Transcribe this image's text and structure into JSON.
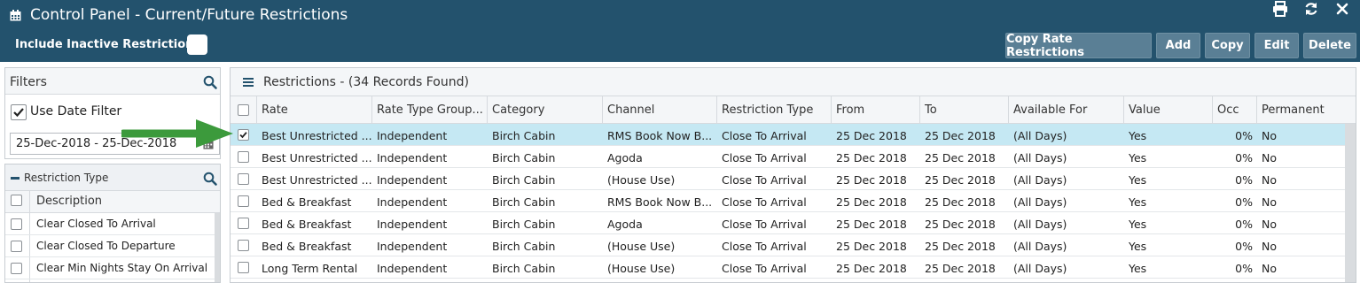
{
  "window": {
    "title": "Control Panel - Current/Future Restrictions",
    "icons": [
      "calendar-icon",
      "print-icon",
      "refresh-icon",
      "close-icon"
    ]
  },
  "toolbar": {
    "include_inactive_label": "Include Inactive Restrictions",
    "include_inactive_checked": false,
    "buttons": {
      "copy_rate_restrictions": "Copy Rate Restrictions",
      "add": "Add",
      "copy": "Copy",
      "edit": "Edit",
      "delete": "Delete"
    }
  },
  "filters": {
    "title": "Filters",
    "use_date_filter_label": "Use Date Filter",
    "use_date_filter_checked": true,
    "date_range_value": "25-Dec-2018 - 25-Dec-2018"
  },
  "restriction_type_filter": {
    "title": "Restriction Type",
    "column_header": "Description",
    "items": [
      "Clear Closed To Arrival",
      "Clear Closed To Departure",
      "Clear Min Nights Stay On Arrival"
    ]
  },
  "grid": {
    "title": "Restrictions - (34 Records Found)",
    "columns": [
      "Rate",
      "Rate Type Group...",
      "Category",
      "Channel",
      "Restriction Type",
      "From",
      "To",
      "Available For",
      "Value",
      "Occ",
      "Permanent"
    ],
    "rows": [
      {
        "selected": true,
        "rate": "Best Unrestricted ...",
        "rate_type_group": "Independent",
        "category": "Birch Cabin",
        "channel": "RMS Book Now B...",
        "restriction_type": "Close To Arrival",
        "from": "25 Dec 2018",
        "to": "25 Dec 2018",
        "available_for": "(All Days)",
        "value": "Yes",
        "occ": "0%",
        "permanent": "No"
      },
      {
        "selected": false,
        "rate": "Best Unrestricted ...",
        "rate_type_group": "Independent",
        "category": "Birch Cabin",
        "channel": "Agoda",
        "restriction_type": "Close To Arrival",
        "from": "25 Dec 2018",
        "to": "25 Dec 2018",
        "available_for": "(All Days)",
        "value": "Yes",
        "occ": "0%",
        "permanent": "No"
      },
      {
        "selected": false,
        "rate": "Best Unrestricted ...",
        "rate_type_group": "Independent",
        "category": "Birch Cabin",
        "channel": "(House Use)",
        "restriction_type": "Close To Arrival",
        "from": "25 Dec 2018",
        "to": "25 Dec 2018",
        "available_for": "(All Days)",
        "value": "Yes",
        "occ": "0%",
        "permanent": "No"
      },
      {
        "selected": false,
        "rate": "Bed & Breakfast",
        "rate_type_group": "Independent",
        "category": "Birch Cabin",
        "channel": "RMS Book Now B...",
        "restriction_type": "Close To Arrival",
        "from": "25 Dec 2018",
        "to": "25 Dec 2018",
        "available_for": "(All Days)",
        "value": "Yes",
        "occ": "0%",
        "permanent": "No"
      },
      {
        "selected": false,
        "rate": "Bed & Breakfast",
        "rate_type_group": "Independent",
        "category": "Birch Cabin",
        "channel": "Agoda",
        "restriction_type": "Close To Arrival",
        "from": "25 Dec 2018",
        "to": "25 Dec 2018",
        "available_for": "(All Days)",
        "value": "Yes",
        "occ": "0%",
        "permanent": "No"
      },
      {
        "selected": false,
        "rate": "Bed & Breakfast",
        "rate_type_group": "Independent",
        "category": "Birch Cabin",
        "channel": "(House Use)",
        "restriction_type": "Close To Arrival",
        "from": "25 Dec 2018",
        "to": "25 Dec 2018",
        "available_for": "(All Days)",
        "value": "Yes",
        "occ": "0%",
        "permanent": "No"
      },
      {
        "selected": false,
        "rate": "Long Term Rental",
        "rate_type_group": "Independent",
        "category": "Birch Cabin",
        "channel": "(House Use)",
        "restriction_type": "Close To Arrival",
        "from": "25 Dec 2018",
        "to": "25 Dec 2018",
        "available_for": "(All Days)",
        "value": "Yes",
        "occ": "0%",
        "permanent": "No"
      }
    ]
  },
  "colors": {
    "header_bg": "#23526d",
    "button_bg": "#5a7f95",
    "selected_row": "#c5e8f3",
    "arrow": "#3c9a3c"
  }
}
